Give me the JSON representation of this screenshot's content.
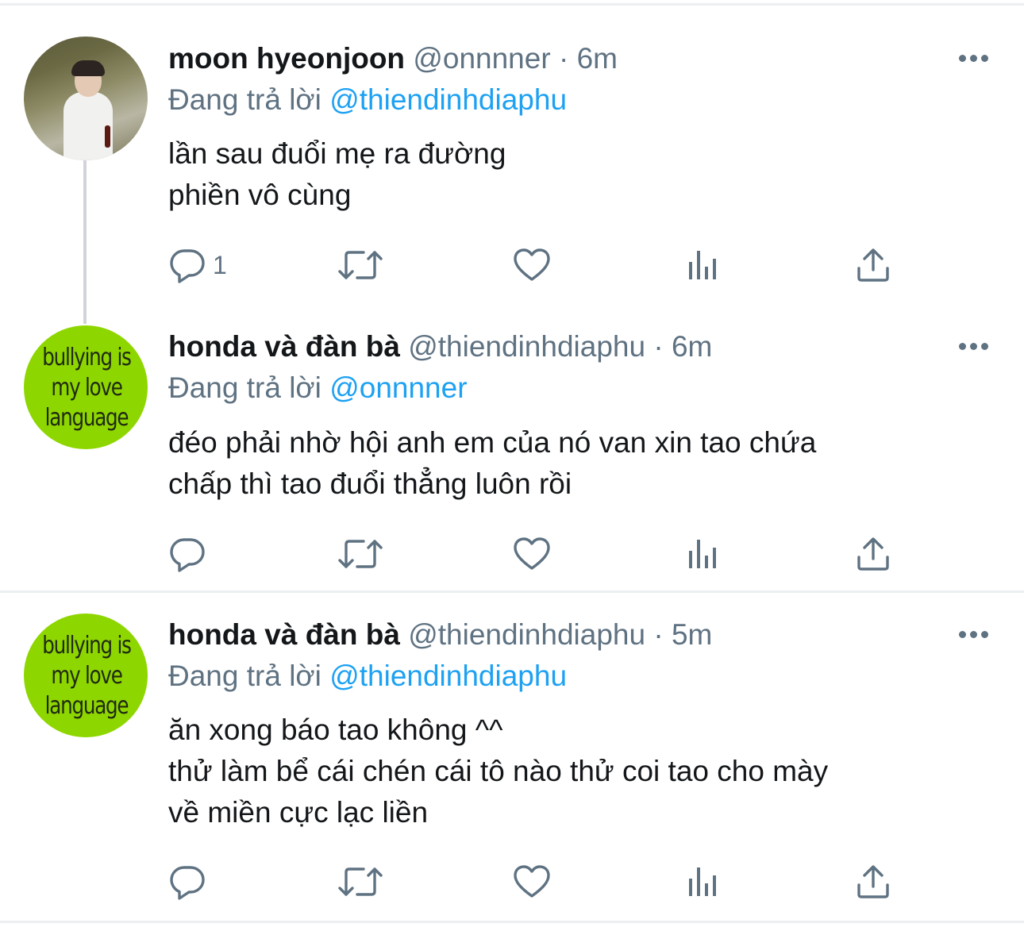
{
  "colors": {
    "text_primary": "#14171a",
    "text_secondary": "#5f7282",
    "mention": "#1da1f2",
    "divider": "#eceff1",
    "avatar_green": "#8ed600"
  },
  "icons": {
    "reply": "reply-icon",
    "retweet": "retweet-icon",
    "like": "heart-icon",
    "analytics": "analytics-icon",
    "share": "share-icon",
    "more": "more-icon"
  },
  "tweets": [
    {
      "display_name": "moon hyeonjoon",
      "handle": "@onnnner",
      "separator": "·",
      "time": "6m",
      "reply_prefix": "Đang trả lời",
      "reply_to": "@thiendinhdiaphu",
      "lines": [
        "lần sau đuổi mẹ ra đường",
        "phiền vô cùng"
      ],
      "reply_count": "1",
      "avatar": "photo"
    },
    {
      "display_name": "honda và đàn bà",
      "handle": "@thiendinhdiaphu",
      "separator": "·",
      "time": "6m",
      "reply_prefix": "Đang trả lời",
      "reply_to": "@onnnner",
      "lines": [
        "đéo phải nhờ hội anh em của nó van xin tao chứa",
        "chấp thì tao đuổi thẳng luôn rồi"
      ],
      "reply_count": "",
      "avatar_text": [
        "bullying is",
        "my love",
        "language"
      ]
    },
    {
      "display_name": "honda và đàn bà",
      "handle": "@thiendinhdiaphu",
      "separator": "·",
      "time": "5m",
      "reply_prefix": "Đang trả lời",
      "reply_to": "@thiendinhdiaphu",
      "lines": [
        "ăn xong báo tao không ^^",
        "thử làm bể cái chén cái tô nào thử coi tao cho mày",
        "về miền cực lạc liền"
      ],
      "reply_count": "",
      "avatar_text": [
        "bullying is",
        "my love",
        "language"
      ]
    }
  ]
}
